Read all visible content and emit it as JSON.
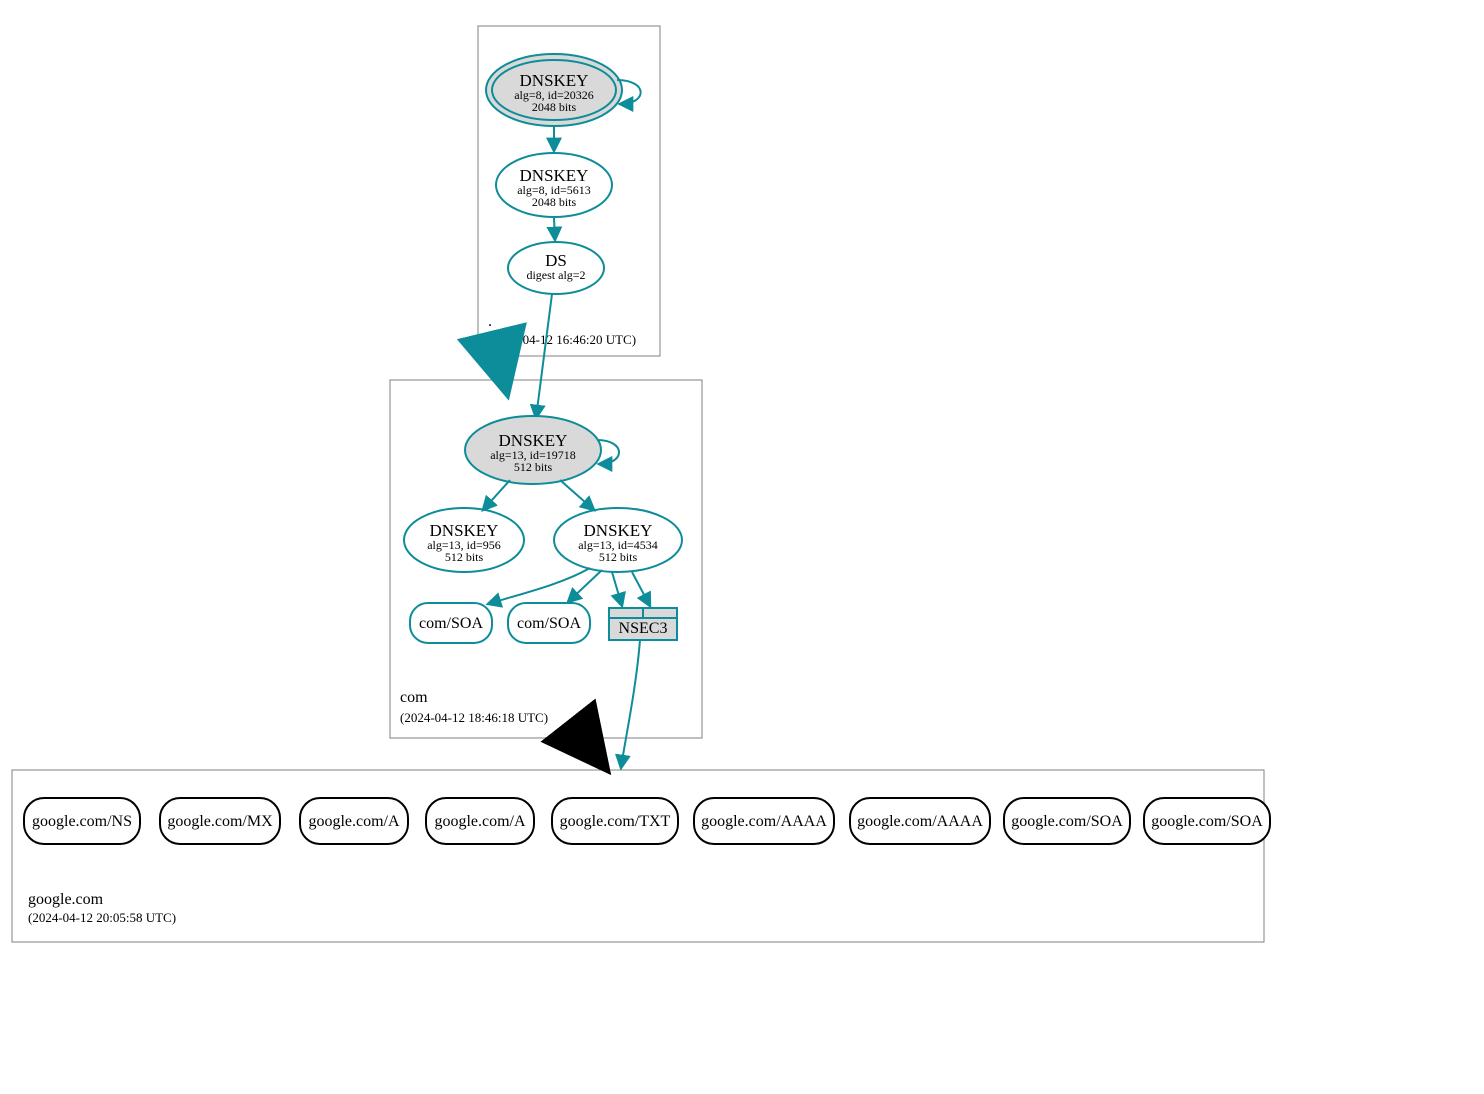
{
  "colors": {
    "teal": "#0d8c99",
    "gray_fill": "#d9d9d9",
    "zone_border": "#808080",
    "black": "#000000"
  },
  "zones": {
    "root": {
      "label": ".",
      "timestamp": "(2024-04-12 16:46:20 UTC)"
    },
    "com": {
      "label": "com",
      "timestamp": "(2024-04-12 18:46:18 UTC)"
    },
    "google": {
      "label": "google.com",
      "timestamp": "(2024-04-12 20:05:58 UTC)"
    }
  },
  "nodes": {
    "root_ksk": {
      "title": "DNSKEY",
      "line1": "alg=8, id=20326",
      "line2": "2048 bits"
    },
    "root_zsk": {
      "title": "DNSKEY",
      "line1": "alg=8, id=5613",
      "line2": "2048 bits"
    },
    "root_ds": {
      "title": "DS",
      "line1": "digest alg=2"
    },
    "com_ksk": {
      "title": "DNSKEY",
      "line1": "alg=13, id=19718",
      "line2": "512 bits"
    },
    "com_zsk1": {
      "title": "DNSKEY",
      "line1": "alg=13, id=956",
      "line2": "512 bits"
    },
    "com_zsk2": {
      "title": "DNSKEY",
      "line1": "alg=13, id=4534",
      "line2": "512 bits"
    },
    "com_soa1": {
      "label": "com/SOA"
    },
    "com_soa2": {
      "label": "com/SOA"
    },
    "com_nsec3": {
      "label": "NSEC3"
    },
    "g_ns": {
      "label": "google.com/NS"
    },
    "g_mx": {
      "label": "google.com/MX"
    },
    "g_a1": {
      "label": "google.com/A"
    },
    "g_a2": {
      "label": "google.com/A"
    },
    "g_txt": {
      "label": "google.com/TXT"
    },
    "g_aaaa1": {
      "label": "google.com/AAAA"
    },
    "g_aaaa2": {
      "label": "google.com/AAAA"
    },
    "g_soa1": {
      "label": "google.com/SOA"
    },
    "g_soa2": {
      "label": "google.com/SOA"
    }
  }
}
